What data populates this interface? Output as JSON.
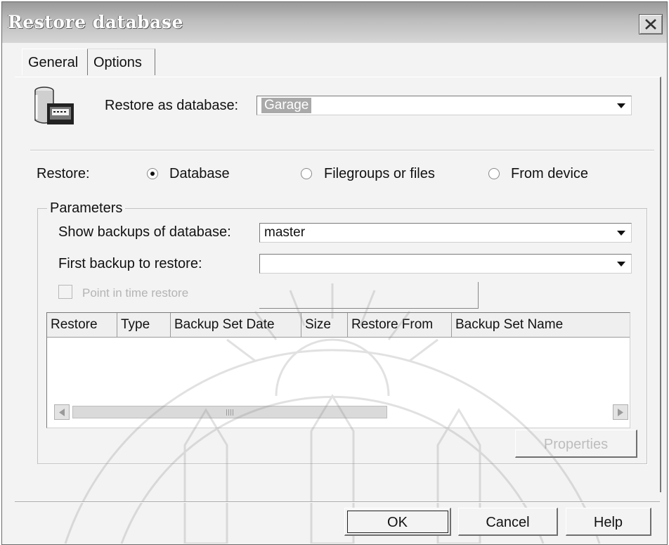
{
  "window": {
    "title": "Restore database"
  },
  "tabs": [
    {
      "label": "General",
      "active": true
    },
    {
      "label": "Options",
      "active": false
    }
  ],
  "restore_as": {
    "label": "Restore as database:",
    "value": "Garage"
  },
  "restore": {
    "label": "Restore:",
    "options": [
      {
        "label": "Database",
        "checked": true
      },
      {
        "label": "Filegroups or files",
        "checked": false
      },
      {
        "label": "From device",
        "checked": false
      }
    ]
  },
  "parameters": {
    "legend": "Parameters",
    "show_backups_label": "Show backups of database:",
    "show_backups_value": "master",
    "first_backup_label": "First backup to restore:",
    "first_backup_value": "",
    "point_in_time_label": "Point in time restore",
    "point_in_time_checked": false
  },
  "backup_list": {
    "columns": [
      "Restore",
      "Type",
      "Backup Set Date",
      "Size",
      "Restore From",
      "Backup Set Name"
    ],
    "rows": []
  },
  "buttons": {
    "properties": "Properties",
    "ok": "OK",
    "cancel": "Cancel",
    "help": "Help"
  },
  "icons": {
    "close": "close-icon",
    "database": "database-icon",
    "dropdown": "chevron-down-icon"
  },
  "colors": {
    "title_bar": "#b0b0b0",
    "dialog_bg": "#f3f3f3",
    "selection": "#a9a9a9"
  }
}
